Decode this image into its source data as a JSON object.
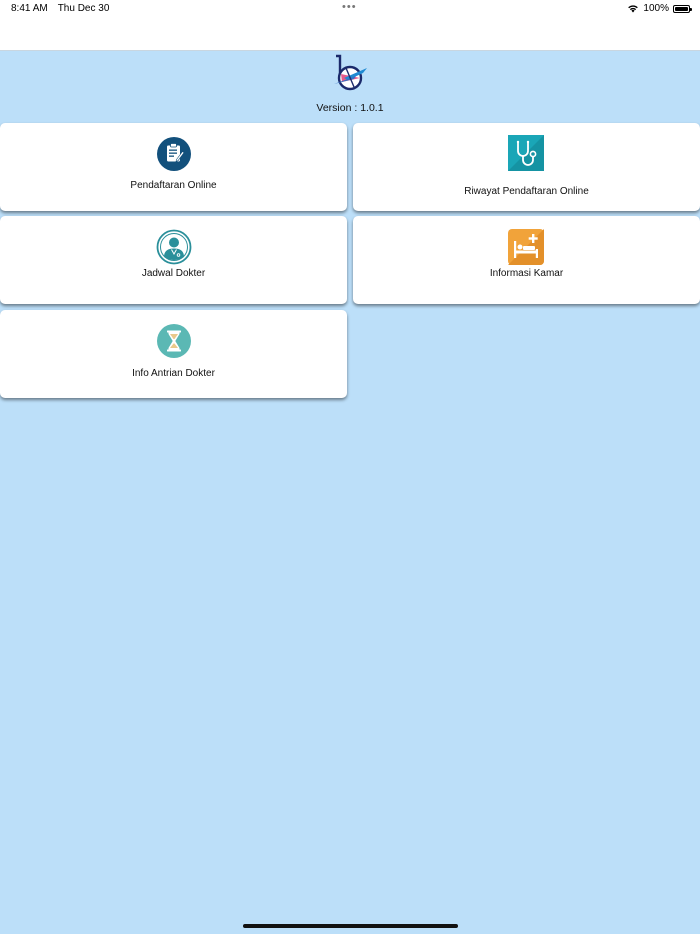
{
  "status_bar": {
    "time": "8:41 AM",
    "date": "Thu Dec 30",
    "dots": "•••",
    "battery": "100%",
    "battery_level": 1.0
  },
  "app": {
    "version": "Version : 1.0.1"
  },
  "menu": {
    "items": [
      {
        "label": "Pendaftaran Online",
        "icon": "clipboard-icon",
        "color": "#12507c"
      },
      {
        "label": "Riwayat Pendaftaran Online",
        "icon": "stethoscope-icon",
        "color": "#1aa6b7"
      },
      {
        "label": "Jadwal Dokter",
        "icon": "doctor-icon",
        "color": "#2a8f9a"
      },
      {
        "label": "Informasi Kamar",
        "icon": "hospital-bed-icon",
        "color": "#f1a33a"
      },
      {
        "label": "Info Antrian Dokter",
        "icon": "hourglass-icon",
        "color": "#5bb8b4"
      }
    ]
  }
}
